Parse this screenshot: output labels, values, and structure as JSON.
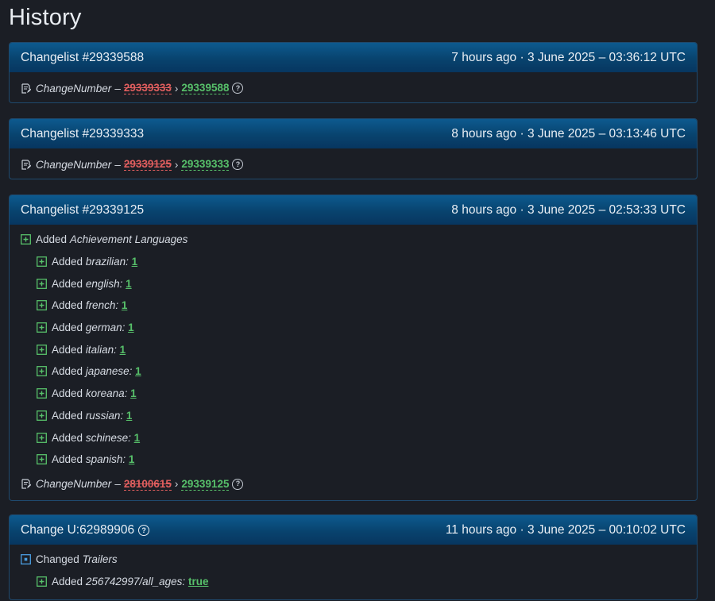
{
  "page": {
    "title": "History"
  },
  "colors": {
    "header_bg": "#08436e",
    "removed": "#e05e5e",
    "added": "#57c06a",
    "page_bg": "#1b1e25"
  },
  "cards": [
    {
      "title": "Changelist #29339588",
      "time": "7 hours ago · 3 June 2025 – 03:36:12 UTC",
      "changenumber": {
        "label": "ChangeNumber",
        "dash": "–",
        "old": "29339333",
        "arrow": "›",
        "new": "29339588"
      }
    },
    {
      "title": "Changelist #29339333",
      "time": "8 hours ago · 3 June 2025 – 03:13:46 UTC",
      "changenumber": {
        "label": "ChangeNumber",
        "dash": "–",
        "old": "29339125",
        "arrow": "›",
        "new": "29339333"
      }
    },
    {
      "title": "Changelist #29339125",
      "time": "8 hours ago · 3 June 2025 – 02:53:33 UTC",
      "group": {
        "verb": "Added",
        "name": "Achievement Languages"
      },
      "items": [
        {
          "verb": "Added",
          "key": "brazilian:",
          "value": "1"
        },
        {
          "verb": "Added",
          "key": "english:",
          "value": "1"
        },
        {
          "verb": "Added",
          "key": "french:",
          "value": "1"
        },
        {
          "verb": "Added",
          "key": "german:",
          "value": "1"
        },
        {
          "verb": "Added",
          "key": "italian:",
          "value": "1"
        },
        {
          "verb": "Added",
          "key": "japanese:",
          "value": "1"
        },
        {
          "verb": "Added",
          "key": "koreana:",
          "value": "1"
        },
        {
          "verb": "Added",
          "key": "russian:",
          "value": "1"
        },
        {
          "verb": "Added",
          "key": "schinese:",
          "value": "1"
        },
        {
          "verb": "Added",
          "key": "spanish:",
          "value": "1"
        }
      ],
      "changenumber": {
        "label": "ChangeNumber",
        "dash": "–",
        "old": "28100615",
        "arrow": "›",
        "new": "29339125"
      }
    },
    {
      "title": "Change U:62989906",
      "time": "11 hours ago · 3 June 2025 – 00:10:02 UTC",
      "group": {
        "verb": "Changed",
        "name": "Trailers"
      },
      "items": [
        {
          "verb": "Added",
          "key": "256742997/all_ages:",
          "value": "true"
        }
      ]
    }
  ],
  "icons": {
    "changenumber": "document-edit-icon",
    "added": "plus-square-icon",
    "changed": "dot-square-icon",
    "help": "question-circle-icon"
  }
}
